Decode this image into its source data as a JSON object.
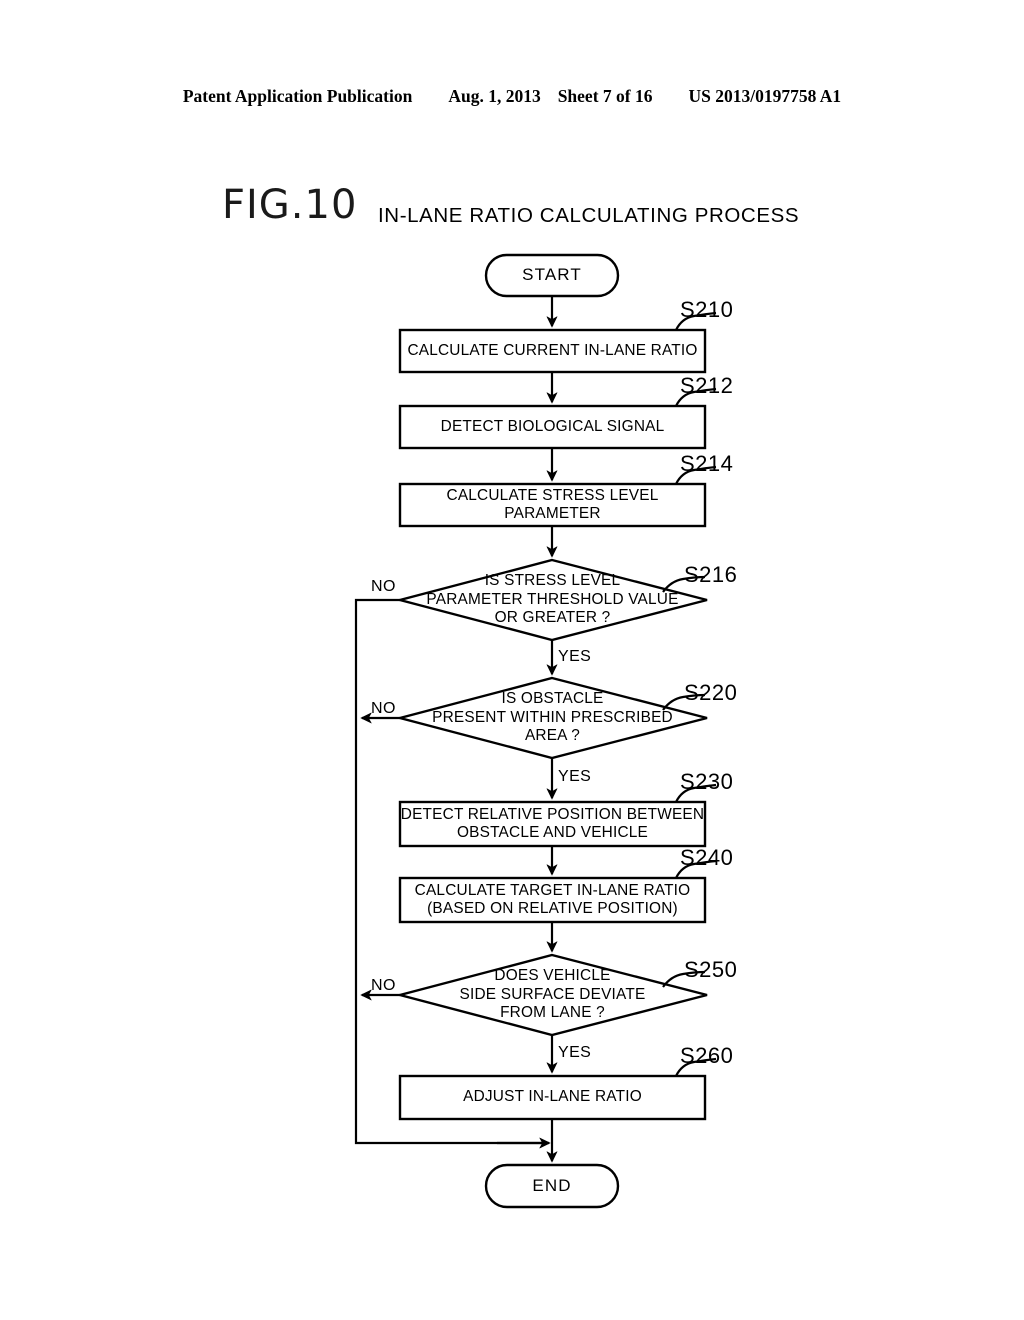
{
  "header": {
    "publication": "Patent Application Publication",
    "date": "Aug. 1, 2013",
    "sheet": "Sheet 7 of 16",
    "doc_number": "US 2013/0197758 A1"
  },
  "figure": {
    "label": "FIG.10",
    "title": "IN-LANE RATIO CALCULATING PROCESS"
  },
  "flowchart": {
    "start": "START",
    "end": "END",
    "nodes": [
      {
        "id": "S210",
        "kind": "process",
        "text": "CALCULATE CURRENT IN-LANE RATIO"
      },
      {
        "id": "S212",
        "kind": "process",
        "text": "DETECT BIOLOGICAL SIGNAL"
      },
      {
        "id": "S214",
        "kind": "process",
        "text": "CALCULATE STRESS LEVEL PARAMETER"
      },
      {
        "id": "S216",
        "kind": "decision",
        "text": "IS STRESS LEVEL\nPARAMETER THRESHOLD VALUE\nOR GREATER ?"
      },
      {
        "id": "S220",
        "kind": "decision",
        "text": "IS OBSTACLE\nPRESENT WITHIN PRESCRIBED\nAREA ?"
      },
      {
        "id": "S230",
        "kind": "process",
        "text": "DETECT RELATIVE POSITION BETWEEN\nOBSTACLE AND VEHICLE"
      },
      {
        "id": "S240",
        "kind": "process",
        "text": "CALCULATE TARGET IN-LANE RATIO\n(BASED ON RELATIVE POSITION)"
      },
      {
        "id": "S250",
        "kind": "decision",
        "text": "DOES VEHICLE\nSIDE SURFACE DEVIATE\nFROM LANE ?"
      },
      {
        "id": "S260",
        "kind": "process",
        "text": "ADJUST IN-LANE RATIO"
      }
    ],
    "edge_labels": {
      "s216_no": "NO",
      "s216_yes": "YES",
      "s220_no": "NO",
      "s220_yes": "YES",
      "s250_no": "NO",
      "s250_yes": "YES"
    }
  },
  "colors": {
    "ink": "#000000",
    "paper": "#ffffff"
  }
}
